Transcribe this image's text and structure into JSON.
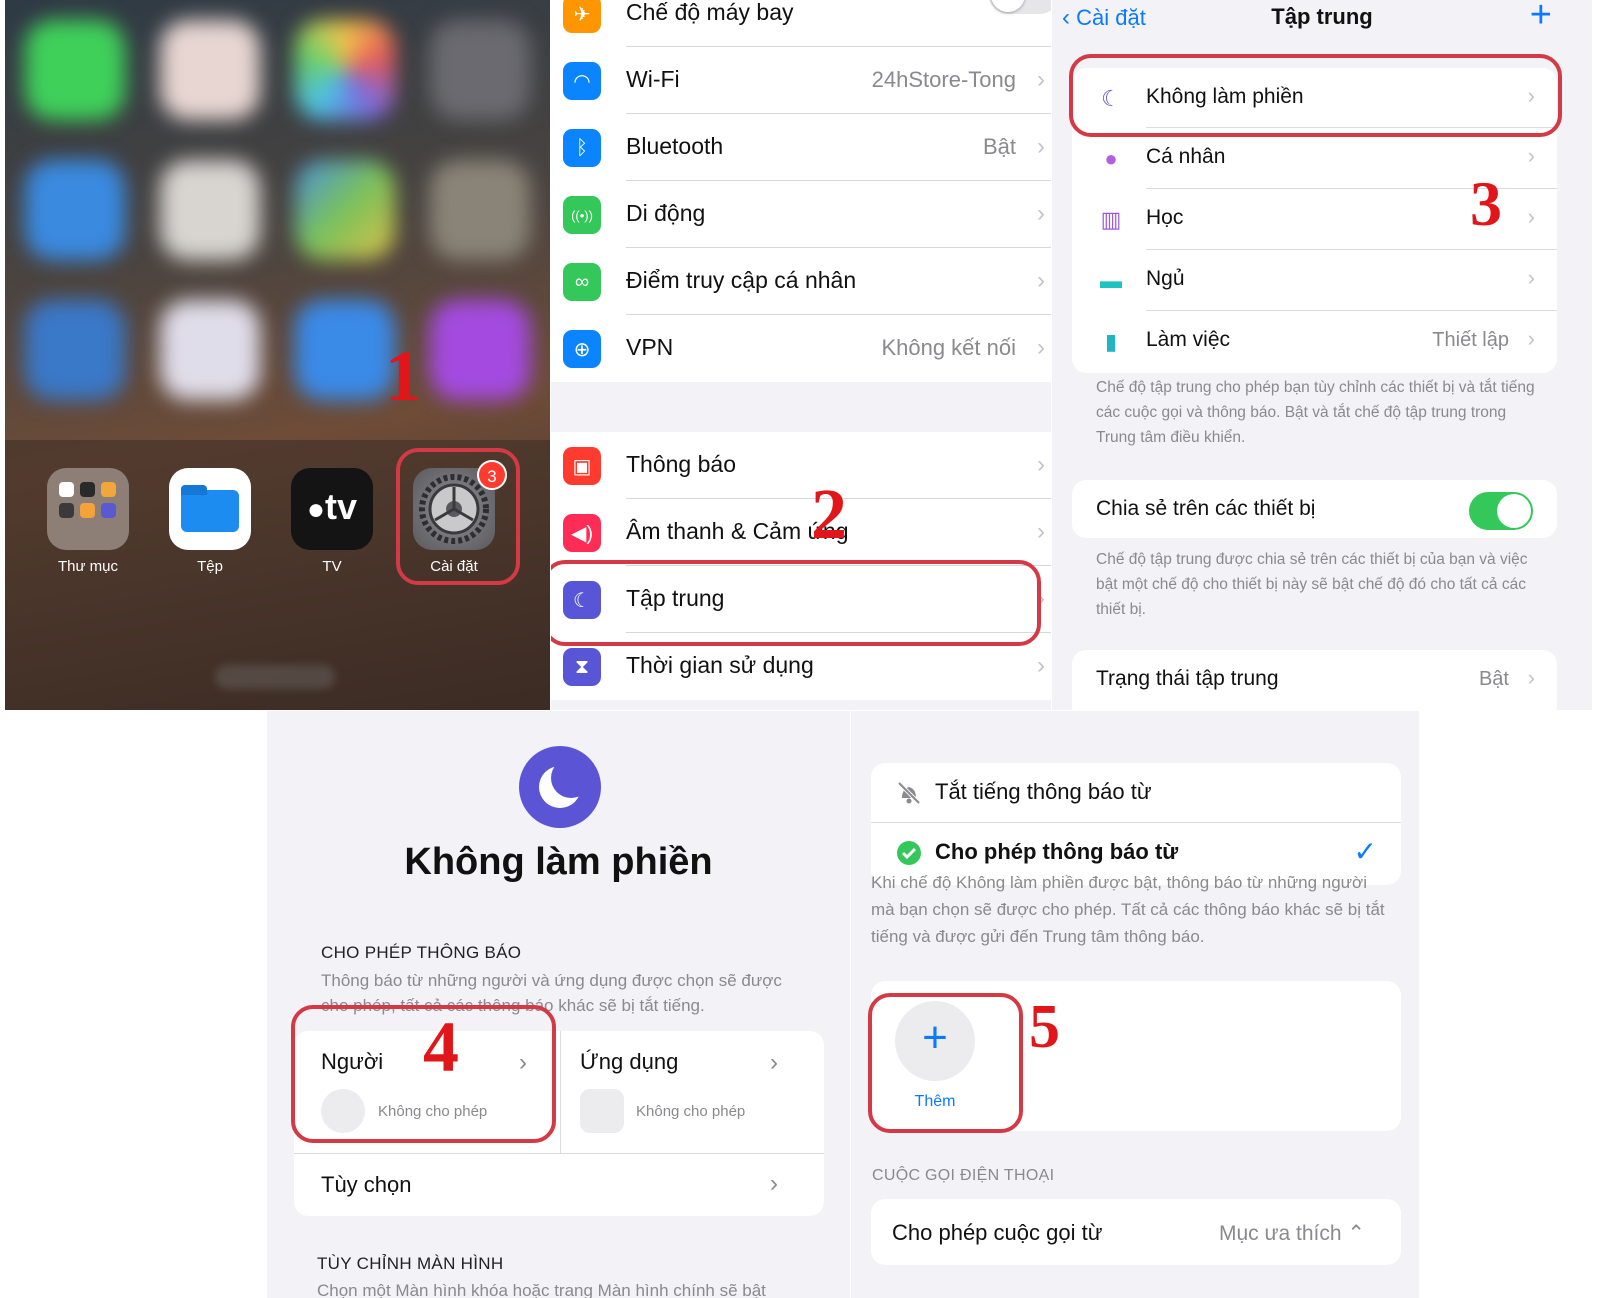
{
  "home": {
    "apps": [
      {
        "icon": "folder-icon",
        "label": "Thư mục"
      },
      {
        "icon": "files-icon",
        "label": "Tệp"
      },
      {
        "icon": "apple-tv-icon",
        "label": "TV",
        "glyph": "tv"
      },
      {
        "icon": "settings-gear-icon",
        "label": "Cài đặt",
        "badge": "3"
      }
    ]
  },
  "settings": {
    "group1": [
      {
        "icon": "airplane-icon",
        "color": "#ff9500",
        "glyph": "✈",
        "label": "Chế độ máy bay",
        "toggle": "off"
      },
      {
        "icon": "wifi-icon",
        "color": "#0a84ff",
        "glyph": "◠",
        "label": "Wi-Fi",
        "value": "24hStore-Tong"
      },
      {
        "icon": "bluetooth-icon",
        "color": "#0a84ff",
        "glyph": "ᛒ",
        "label": "Bluetooth",
        "value": "Bật"
      },
      {
        "icon": "cellular-icon",
        "color": "#34c759",
        "glyph": "((•))",
        "label": "Di động",
        "value": ""
      },
      {
        "icon": "hotspot-icon",
        "color": "#34c759",
        "glyph": "∞",
        "label": "Điểm truy cập cá nhân",
        "value": ""
      },
      {
        "icon": "vpn-globe-icon",
        "color": "#0a84ff",
        "glyph": "⊕",
        "label": "VPN",
        "value": "Không kết nối"
      }
    ],
    "group2": [
      {
        "icon": "notifications-icon",
        "color": "#ff3b30",
        "glyph": "▣",
        "label": "Thông báo"
      },
      {
        "icon": "sounds-icon",
        "color": "#ff2d55",
        "glyph": "◀)",
        "label": "Âm thanh & Cảm ứng"
      },
      {
        "icon": "focus-moon-icon",
        "color": "#5856d6",
        "glyph": "☾",
        "label": "Tập trung"
      },
      {
        "icon": "screen-time-icon",
        "color": "#5856d6",
        "glyph": "⧗",
        "label": "Thời gian sử dụng"
      }
    ]
  },
  "focus": {
    "back": "Cài đặt",
    "title": "Tập trung",
    "plus": "+",
    "modes": [
      {
        "icon": "moon-icon",
        "glyph": "☾",
        "color": "#5b55d6",
        "label": "Không làm phiền",
        "value": ""
      },
      {
        "icon": "person-icon",
        "glyph": "●",
        "color": "#b05fe0",
        "label": "Cá nhân",
        "value": ""
      },
      {
        "icon": "books-icon",
        "glyph": "▥",
        "color": "#9b59e0",
        "label": "Học",
        "value": ""
      },
      {
        "icon": "bed-icon",
        "glyph": "▬",
        "color": "#20c3c0",
        "label": "Ngủ",
        "value": ""
      },
      {
        "icon": "work-badge-icon",
        "glyph": "▮",
        "color": "#20b5c0",
        "label": "Làm việc",
        "value": "Thiết lập"
      }
    ],
    "note1": "Chế độ tập trung cho phép bạn tùy chỉnh các thiết bị và tắt tiếng các cuộc gọi và thông báo. Bật và tắt chế độ tập trung trong Trung tâm điều khiển.",
    "share_label": "Chia sẻ trên các thiết bị",
    "share_toggle": "on",
    "note2": "Chế độ tập trung được chia sẻ trên các thiết bị của bạn và việc bật một chế độ cho thiết bị này sẽ bật chế độ đó cho tất cả các thiết bị.",
    "status_label": "Trạng thái tập trung",
    "status_value": "Bật"
  },
  "dnd": {
    "title": "Không làm phiền",
    "allow_header": "CHO PHÉP THÔNG BÁO",
    "allow_sub": "Thông báo từ những người và ứng dụng được chọn sẽ được cho phép, tất cả các thông báo khác sẽ bị tắt tiếng.",
    "people_label": "Người",
    "people_sub": "Không cho phép",
    "apps_label": "Ứng dụng",
    "apps_sub": "Không cho phép",
    "options_label": "Tùy chọn",
    "customize_header": "TÙY CHỈNH MÀN HÌNH",
    "customize_sub": "Chọn một Màn hình khóa hoặc trang Màn hình chính sẽ bật"
  },
  "allow": {
    "silence_label": "Tắt tiếng thông báo từ",
    "allow_label": "Cho phép thông báo từ",
    "check": "✓",
    "note": "Khi chế độ Không làm phiền được bật, thông báo từ những người mà bạn chọn sẽ được cho phép. Tất cả các thông báo khác sẽ bị tắt tiếng và được gửi đến Trung tâm thông báo.",
    "add_label": "Thêm",
    "calls_header": "CUỘC GỌI ĐIỆN THOẠI",
    "calls_label": "Cho phép cuộc gọi từ",
    "calls_value": "Mục ưa thích ⌃"
  },
  "steps": [
    "1",
    "2",
    "3",
    "4",
    "5"
  ],
  "colors": {
    "accent": "#0a7aff",
    "highlight": "#d43a45",
    "step_number": "#e0161b",
    "toggle_on": "#34c759",
    "focus_purple": "#5b55d6"
  }
}
